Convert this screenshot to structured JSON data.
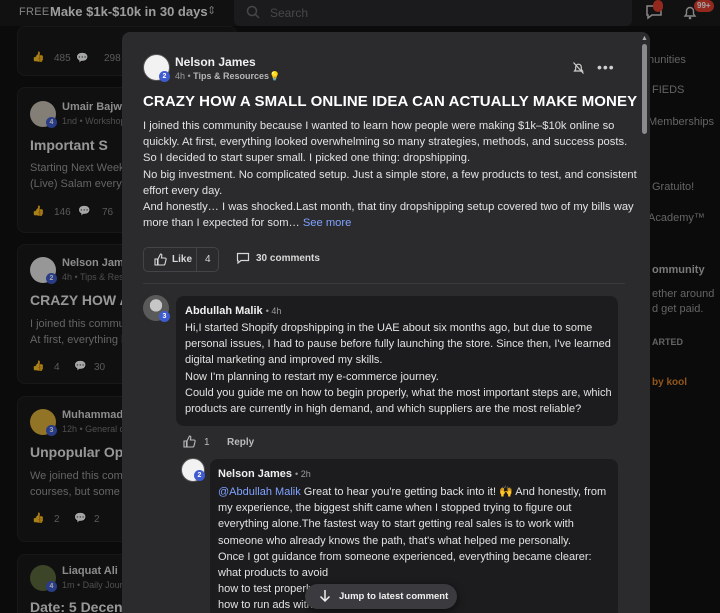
{
  "topbar": {
    "free_label": "FREE",
    "group_name": "Make $1k-$10k in 30 days",
    "search_placeholder": "Search",
    "chat_badge": "",
    "notif_badge": "99+"
  },
  "feed": [
    {
      "likes": "485",
      "comments": "298"
    },
    {
      "author": "Umair Bajwa",
      "avatar_level": "4",
      "meta": "1nd • Workshop",
      "title": "Important S",
      "text": [
        "Starting Next Week",
        "(Live) Salam everyo"
      ],
      "likes": "146",
      "comments": "76"
    },
    {
      "author": "Nelson Jame",
      "avatar_level": "2",
      "meta": "4h • Tips & Reso",
      "title": "CRAZY HOW A",
      "text": [
        "I joined this commu",
        "At first, everything l"
      ],
      "likes": "4",
      "comments": "30"
    },
    {
      "author": "Muhammad",
      "avatar_level": "3",
      "meta": "12h • General d",
      "title": "Unpopular Opin",
      "text": [
        "We joined this comu",
        "courses, but some c"
      ],
      "likes": "2",
      "comments": "2"
    },
    {
      "author": "Liaquat Ali",
      "avatar_level": "4",
      "meta": "1m • Daily Jour",
      "title": "Date: 5 Decen"
    }
  ],
  "right_sidebar": [
    "nunities",
    "FIEDS",
    "Memberships",
    "Gratuito!",
    "Academy™",
    "ommunity",
    "ether around",
    "d get paid.",
    "ARTED",
    "by kool"
  ],
  "post": {
    "author": "Nelson James",
    "avatar_level": "2",
    "time": "4h",
    "category": "Tips & Resources",
    "category_emoji": "💡",
    "title": "CRAZY HOW A SMALL ONLINE IDEA CAN ACTUALLY MAKE MONEY",
    "body": [
      "I joined this community because I wanted to learn how people were making $1k–$10k online so",
      "quickly. At first, everything looked overwhelming so many strategies, methods, and success posts.",
      "So I decided to start super small. I picked one thing: dropshipping.",
      "No big investment. No complicated setup. Just a simple store, a few products to test, and consistent",
      "effort every day.",
      "And honestly… I was shocked.Last month, that tiny dropshipping setup covered two of my bills way"
    ],
    "body_last": "more than I expected for som…",
    "see_more": "See more",
    "like_label": "Like",
    "like_count": "4",
    "comments_label": "30 comments"
  },
  "comments": [
    {
      "author": "Abdullah Malik",
      "time": "4h",
      "avatar_level": "3",
      "lines": [
        "Hi,I started Shopify dropshipping in the UAE about six months ago, but due to some",
        "personal issues, I had to pause before fully launching the store. Since then, I've learned",
        "digital marketing and improved my skills.",
        "Now I'm planning to restart my e-commerce journey.",
        "Could you guide me on how to begin properly, what the most important steps are, which",
        "products are currently in high demand, and which suppliers are the most reliable?"
      ],
      "likes": "1",
      "reply_label": "Reply"
    },
    {
      "author": "Nelson James",
      "time": "2h",
      "avatar_level": "2",
      "mention": "@Abdullah Malik",
      "first_line": " Great to hear you're getting back into it! 🙌 And honestly, from",
      "lines": [
        "my experience, the biggest shift came when I stopped trying to figure out",
        "everything alone.The fastest way to start getting real sales is to work with",
        "someone who already knows the path, that's what helped me personally.",
        "Once I got guidance from someone experienced, everything became clearer:",
        "what products to avoid",
        "how to test properly",
        "how to run ads with"
      ]
    }
  ],
  "jump_label": "Jump to latest comment"
}
